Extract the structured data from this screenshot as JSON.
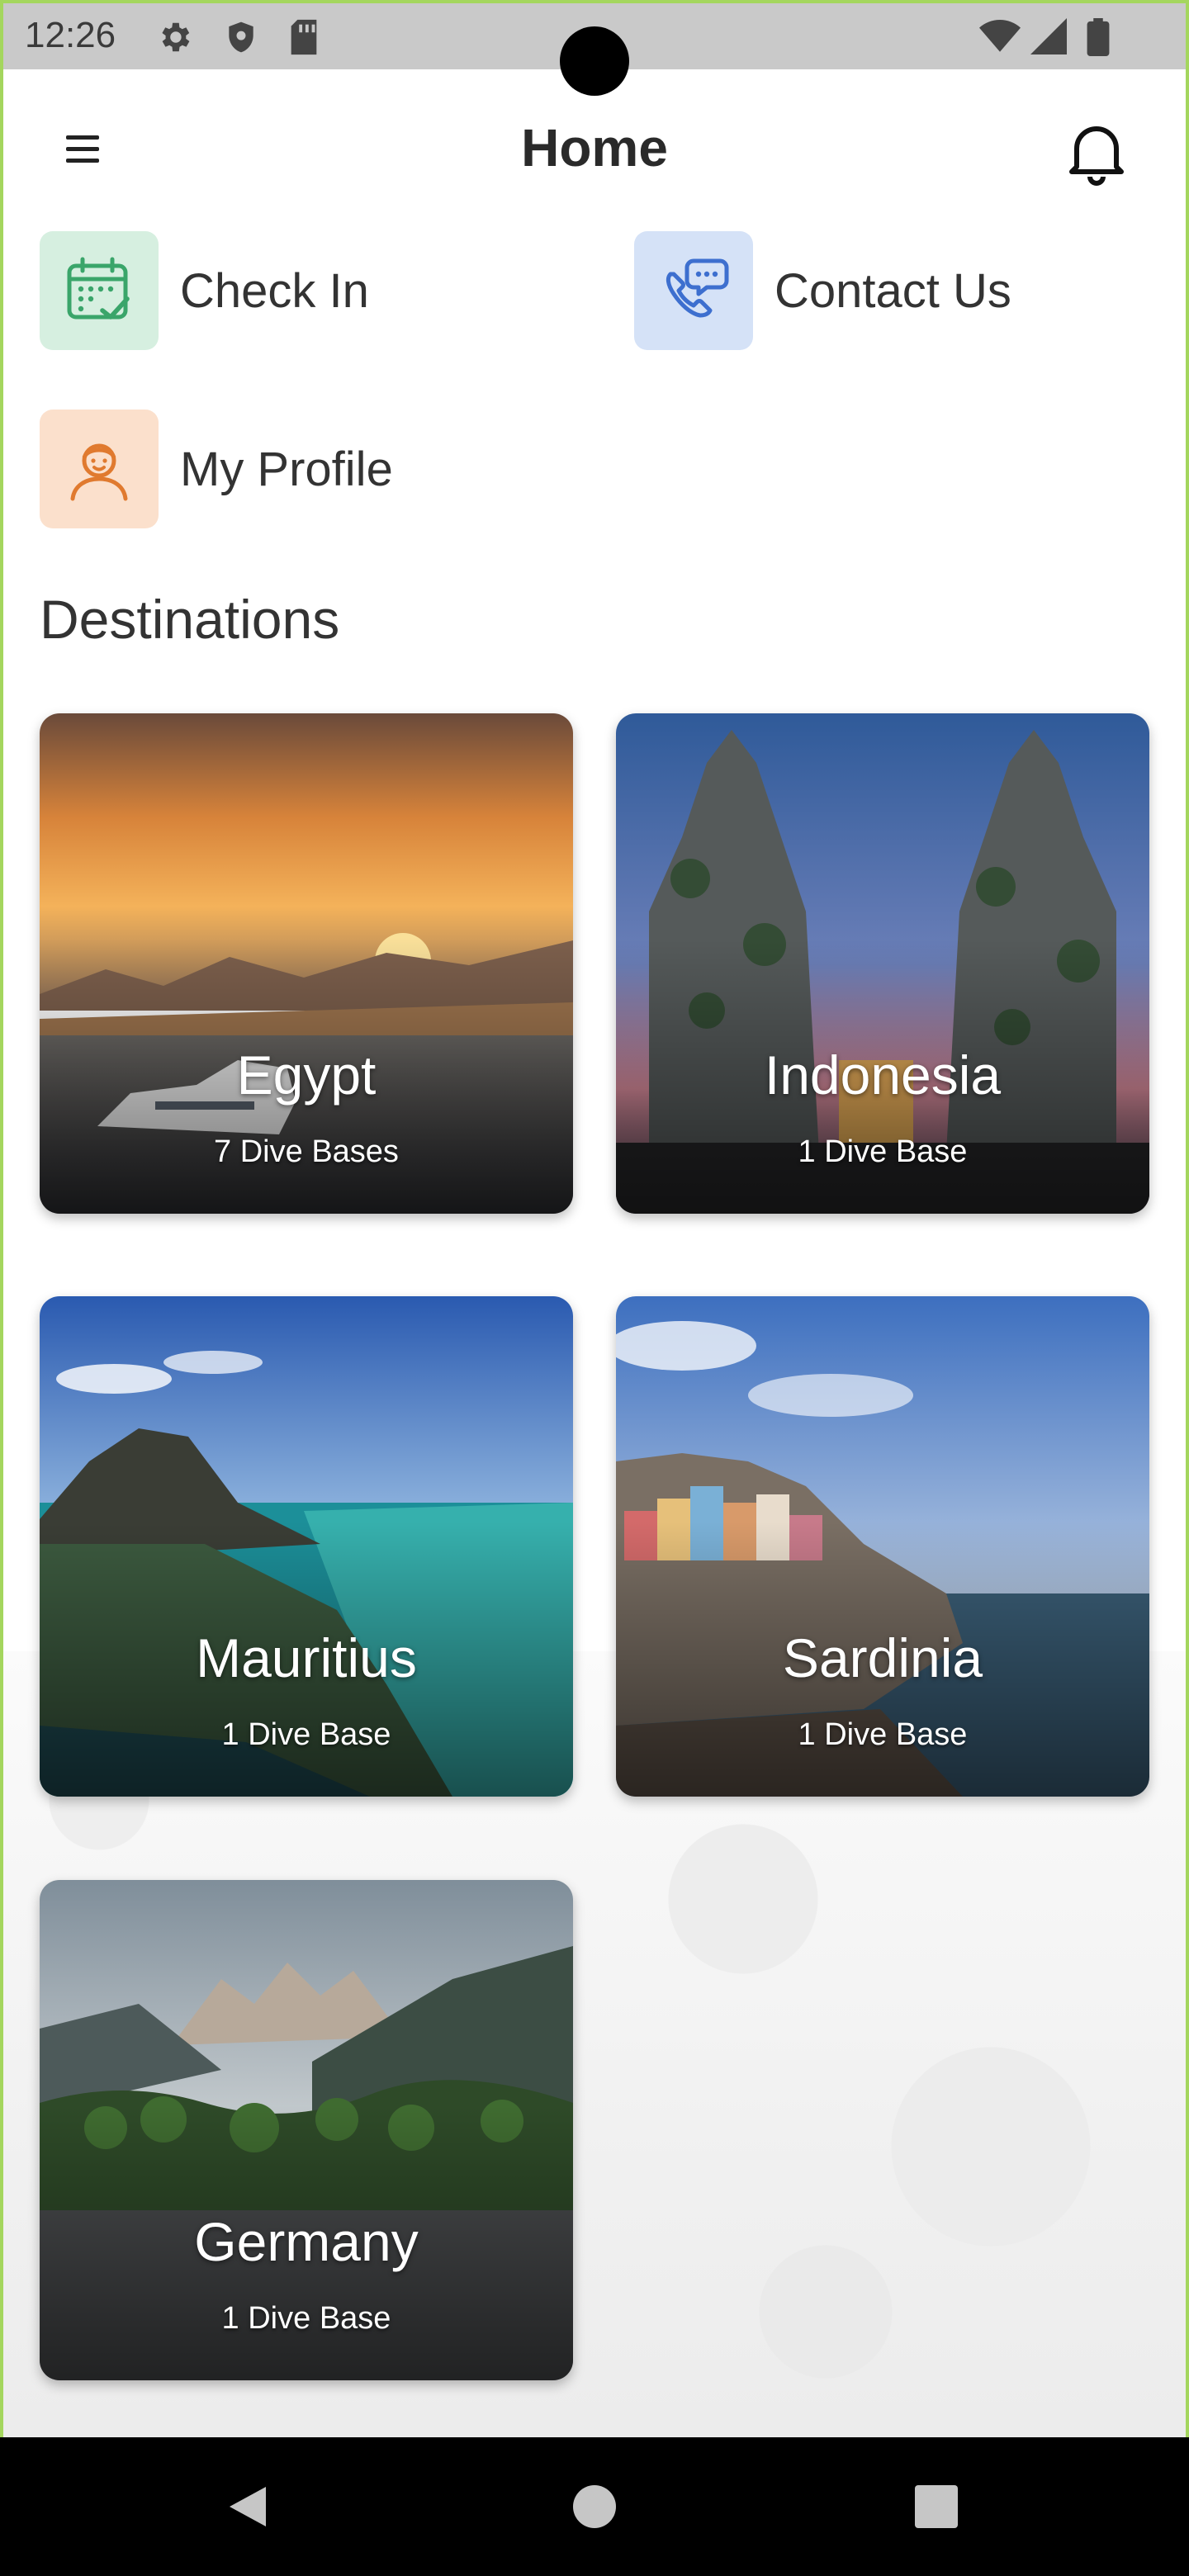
{
  "status_bar": {
    "time": "12:26",
    "left_icons": [
      "gear-icon",
      "shield-icon",
      "sd-card-icon"
    ],
    "right_icons": [
      "wifi-icon",
      "signal-icon",
      "battery-icon"
    ]
  },
  "app_bar": {
    "title": "Home",
    "menu_icon": "hamburger-menu-icon",
    "notification_icon": "bell-icon"
  },
  "quick_actions": [
    {
      "label": "Check In",
      "icon": "calendar-check-icon",
      "tile_color": "#d6efe0",
      "icon_color": "#3aa56a"
    },
    {
      "label": "Contact Us",
      "icon": "phone-chat-icon",
      "tile_color": "#d5e2f7",
      "icon_color": "#3d6fcf"
    },
    {
      "label": "My Profile",
      "icon": "person-icon",
      "tile_color": "#fbe0cc",
      "icon_color": "#e07a2f"
    }
  ],
  "destinations": {
    "title": "Destinations",
    "items": [
      {
        "name": "Egypt",
        "subtitle": "7 Dive Bases"
      },
      {
        "name": "Indonesia",
        "subtitle": "1 Dive Base"
      },
      {
        "name": "Mauritius",
        "subtitle": "1 Dive Base"
      },
      {
        "name": "Sardinia",
        "subtitle": "1 Dive Base"
      },
      {
        "name": "Germany",
        "subtitle": "1 Dive Base"
      }
    ]
  },
  "nav_bar": {
    "buttons": [
      "back-icon",
      "home-icon",
      "recents-icon"
    ]
  }
}
